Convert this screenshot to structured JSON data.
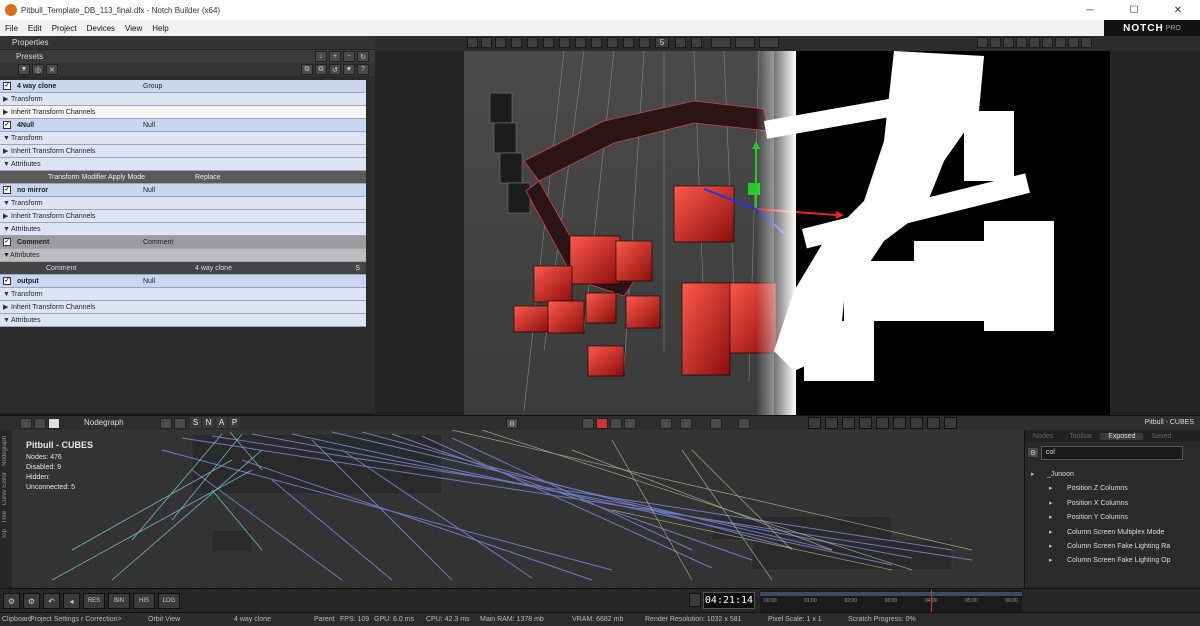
{
  "window": {
    "title": "Pitbull_Template_DB_113_final.dfx - Notch Builder (x64)",
    "minimize": "─",
    "maximize": "☐",
    "close": "✕",
    "logo": "NOTCH",
    "logo_sub": "PRO"
  },
  "menu": [
    "File",
    "Edit",
    "Project",
    "Devices",
    "View",
    "Help"
  ],
  "properties": {
    "header": "Properties",
    "presets_label": "Presets",
    "tree": [
      {
        "kind": "node",
        "name": "4 way clone",
        "type": "Group"
      },
      {
        "kind": "sec",
        "name": "Transform"
      },
      {
        "kind": "white",
        "name": "Inherit Transform Channels"
      },
      {
        "kind": "node",
        "name": "4Null",
        "type": "Null"
      },
      {
        "kind": "sec",
        "name": "Transform"
      },
      {
        "kind": "sec",
        "name": "Inherit Transform Channels"
      },
      {
        "kind": "sec",
        "name": "Attributes"
      },
      {
        "kind": "dark",
        "name": "Transform Modifier Apply Mode",
        "value": "Replace"
      },
      {
        "kind": "node",
        "name": "no mirror",
        "type": "Null"
      },
      {
        "kind": "sec",
        "name": "Transform"
      },
      {
        "kind": "sec",
        "name": "Inherit Transform Channels"
      },
      {
        "kind": "sec",
        "name": "Attributes"
      },
      {
        "kind": "gray",
        "name": "Comment",
        "type": "Comment"
      },
      {
        "kind": "secgray",
        "name": "Attributes"
      },
      {
        "kind": "comment",
        "name": "Comment",
        "value": "4 way clone",
        "suffix": "S"
      },
      {
        "kind": "node",
        "name": "output",
        "type": "Null"
      },
      {
        "kind": "sec",
        "name": "Transform"
      },
      {
        "kind": "sec",
        "name": "Inherit Transform Channels"
      },
      {
        "kind": "sec",
        "name": "Attributes"
      }
    ]
  },
  "viewport_toolbar": {
    "snap_count": "5"
  },
  "nodegraph": {
    "title": "Nodegraph",
    "snap_letters": [
      "S",
      "N",
      "A",
      "P"
    ],
    "side_tabs": [
      "Nodegraph",
      "Curve Editor",
      "Tree",
      "Top"
    ],
    "scene_name": "Pitbull - CUBES",
    "info_title": "Pitbull  -  CUBES",
    "stats": [
      {
        "label": "Nodes:",
        "value": "476"
      },
      {
        "label": "Disabled:",
        "value": "9"
      },
      {
        "label": "Hidden:",
        "value": ""
      },
      {
        "label": "Unconnected:",
        "value": "5"
      }
    ]
  },
  "exposed_panel": {
    "tabs": [
      "Nodes",
      "Toolbar",
      "Exposed",
      "Saved"
    ],
    "active_tab": "Exposed",
    "search_value": "col",
    "items": [
      {
        "kind": "g",
        "label": "_Junoon"
      },
      {
        "kind": "i",
        "label": "Position Z Columns"
      },
      {
        "kind": "i",
        "label": "Position X Columns"
      },
      {
        "kind": "i",
        "label": "Position Y Columns"
      },
      {
        "kind": "i",
        "label": "Column Screen Multiplex Mode"
      },
      {
        "kind": "i",
        "label": "Column Screen Fake Lighting Ra"
      },
      {
        "kind": "i",
        "label": "Column Screen Fake Lighting Op"
      }
    ]
  },
  "bottom_toolbar": {
    "text_buttons": [
      "RES",
      "BIN",
      "HIS",
      "LOG"
    ],
    "timecode": "04:21:14",
    "timeline_labels": [
      "00:00",
      "01:00",
      "02:00",
      "03:00",
      "04:00",
      "05:00",
      "06:00"
    ]
  },
  "status": {
    "clipboard": "Clipboard",
    "color_correction": "Project Settings  r Correction>",
    "orbit": "Orbit View",
    "selection": "4 way clone",
    "parent": "Parent",
    "fps": "FPS: 109",
    "gpu": "GPU: 6.0 ms",
    "cpu": "CPU: 42.3 ms",
    "ram": "Main RAM: 1378 mb",
    "vram": "VRAM: 6682 mb",
    "resolution": "Render Resolution: 1032 x 581",
    "pixel_scale": "Pixel Scale: 1 x 1",
    "scratch": "Scratch Progress: 0%"
  }
}
